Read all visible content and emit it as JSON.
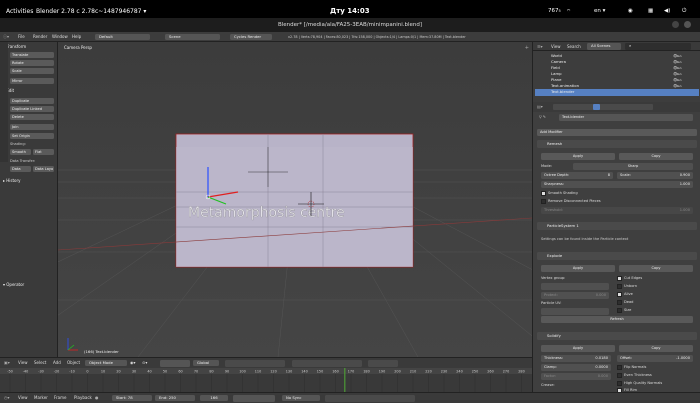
{
  "gnome": {
    "activities": "Activities",
    "app_name": "Blender 2.78 c 2.78c~1487946787 ▾",
    "clock": "Дту 14:03",
    "status": "767₅",
    "lang": "en ▾",
    "sound_icon": "speaker-icon",
    "power_icon": "power-icon"
  },
  "window": {
    "title": "Blender* [/media/ala/FA25-3EAB/minimpanini.blend]"
  },
  "infobar": {
    "menus": [
      "File",
      "Render",
      "Window",
      "Help"
    ],
    "layout": "Default",
    "scene": "Scene",
    "engine": "Cycles Render",
    "stats": "v2.78 | Verts:78,904 | Faces:80,023 | Tris:158,000 | Objects:1/4 | Lamps:0/1 | Mem:37.80M | Text.blender"
  },
  "tool_shelf": {
    "transform_label": "▾ Transform",
    "transform_buttons": [
      "Translate",
      "Rotate",
      "Scale",
      "Mirror"
    ],
    "edit_label": "▾ Edit",
    "edit_buttons": [
      "Duplicate",
      "Duplicate Linked",
      "Delete"
    ],
    "join_label": "Join",
    "set_origin": "Set Origin",
    "shading_label": "Shading:",
    "smooth": "Smooth",
    "flat": "Flat",
    "data_transfer": "Data Transfer:",
    "data": "Data",
    "data_layout": "Data Layo",
    "history_label": "▸ History",
    "operator_label": "▾ Operator"
  },
  "viewport": {
    "camera_label": "Camera Persp",
    "object_label": "(166) Text.blender",
    "text_3d": "Metamorphosis centre"
  },
  "viewport_header": {
    "view": "View",
    "select": "Select",
    "add": "Add",
    "object": "Object",
    "mode": "Object Mode",
    "orientation": "Global"
  },
  "timeline": {
    "ticks": [
      "-50",
      "-40",
      "-30",
      "-20",
      "-10",
      "0",
      "10",
      "20",
      "30",
      "40",
      "50",
      "60",
      "70",
      "80",
      "90",
      "100",
      "110",
      "120",
      "130",
      "140",
      "150",
      "160",
      "170",
      "180",
      "190",
      "200",
      "210",
      "220",
      "230",
      "240",
      "250",
      "260",
      "270",
      "280"
    ],
    "current_frame": 166
  },
  "timeline_header": {
    "view": "View",
    "marker": "Marker",
    "frame": "Frame",
    "playback": "Playback",
    "start": "Start:",
    "start_val": "78",
    "end": "End:",
    "end_val": "250",
    "frame_val": "166",
    "sync": "No Sync"
  },
  "outliner": {
    "view": "View",
    "search": "Search",
    "scenes": "All Scenes",
    "items": [
      "World",
      "Camera",
      "Field",
      "Lamp",
      "Plane",
      "Text.animation",
      "Text.blender"
    ]
  },
  "properties": {
    "object_name": "Text.blender",
    "add_modifier": "Add Modifier",
    "remesh": {
      "name": "Remesh",
      "apply": "Apply",
      "copy": "Copy",
      "mode_label": "Mode:",
      "mode": "Sharp",
      "octree_depth": "Octree Depth:",
      "octree_val": "8",
      "scale_label": "Scale:",
      "scale_val": "0.900",
      "sharpness_label": "Sharpness:",
      "sharpness_val": "1.000",
      "smooth_shading": "Smooth Shading",
      "remove_disconnected": "Remove Disconnected Pieces",
      "threshold_label": "Threshold:",
      "threshold_val": "1.000"
    },
    "particle": {
      "name": "ParticleSystem 1",
      "note": "Settings can be found inside the Particle context"
    },
    "explode": {
      "name": "Explode",
      "apply": "Apply",
      "copy": "Copy",
      "vertex_group": "Vertex group:",
      "protect_label": "Protect:",
      "protect_val": "0.000",
      "particle_uv": "Particle UV:",
      "cut_edges": "Cut Edges",
      "unborn": "Unborn",
      "alive": "Alive",
      "dead": "Dead",
      "size": "Size",
      "refresh": "Refresh"
    },
    "solidify": {
      "name": "Solidify",
      "apply": "Apply",
      "copy": "Copy",
      "thickness_label": "Thickness:",
      "thickness_val": "0.0180",
      "offset_label": "Offset:",
      "offset_val": "-1.0000",
      "clamp_label": "Clamp:",
      "clamp_val": "0.0000",
      "flip_normals": "Flip Normals",
      "even_thickness": "Even Thickness",
      "high_quality": "High Quality Normals",
      "fill_rim": "Fill Rim",
      "only_rim": "Only Rim",
      "factor_label": "Factor:",
      "factor_val": "0.000",
      "crease": "Crease:"
    }
  },
  "colors": {
    "accent": "#5680c2",
    "panel": "#3f3f3f",
    "header": "#3a3a3a",
    "selection": "#f0a030"
  }
}
